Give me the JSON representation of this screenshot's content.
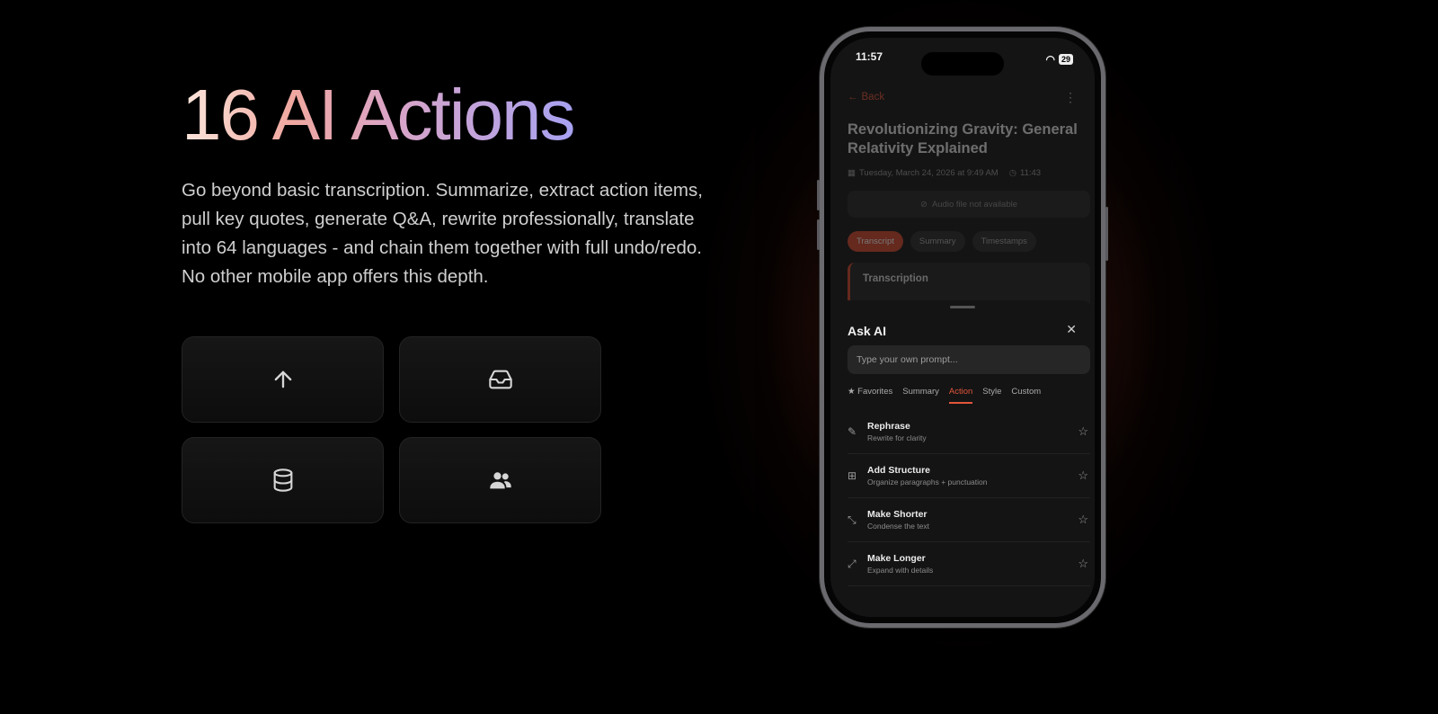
{
  "hero": {
    "headline": "16 AI Actions",
    "description": "Go beyond basic transcription. Summarize, extract action items, pull key quotes, generate Q&A, rewrite professionally, translate into 64 languages - and chain them together with full undo/redo. No other mobile app offers this depth."
  },
  "feature_tiles": [
    {
      "icon": "upload-arrow-icon"
    },
    {
      "icon": "inbox-icon"
    },
    {
      "icon": "database-icon"
    },
    {
      "icon": "users-icon"
    }
  ],
  "phone": {
    "status": {
      "time": "11:57",
      "battery": "29"
    },
    "back_label": "Back",
    "title": "Revolutionizing Gravity: General Relativity Explained",
    "date": "Tuesday, March 24, 2026 at 9:49 AM",
    "duration": "11:43",
    "audio_notice": "Audio file not available",
    "tabs": [
      "Transcript",
      "Summary",
      "Timestamps"
    ],
    "active_tab": "Transcript",
    "section_title": "Transcription",
    "sheet": {
      "title": "Ask AI",
      "prompt_placeholder": "Type your own prompt...",
      "categories": [
        "★ Favorites",
        "Summary",
        "Action",
        "Style",
        "Custom"
      ],
      "active_category": "Action",
      "actions": [
        {
          "label": "Rephrase",
          "desc": "Rewrite for clarity",
          "icon": "edit-icon"
        },
        {
          "label": "Add Structure",
          "desc": "Organize paragraphs + punctuation",
          "icon": "grid-icon"
        },
        {
          "label": "Make Shorter",
          "desc": "Condense the text",
          "icon": "shrink-icon"
        },
        {
          "label": "Make Longer",
          "desc": "Expand with details",
          "icon": "expand-icon"
        }
      ]
    }
  },
  "colors": {
    "accent": "#d4482e",
    "background": "#000000"
  }
}
